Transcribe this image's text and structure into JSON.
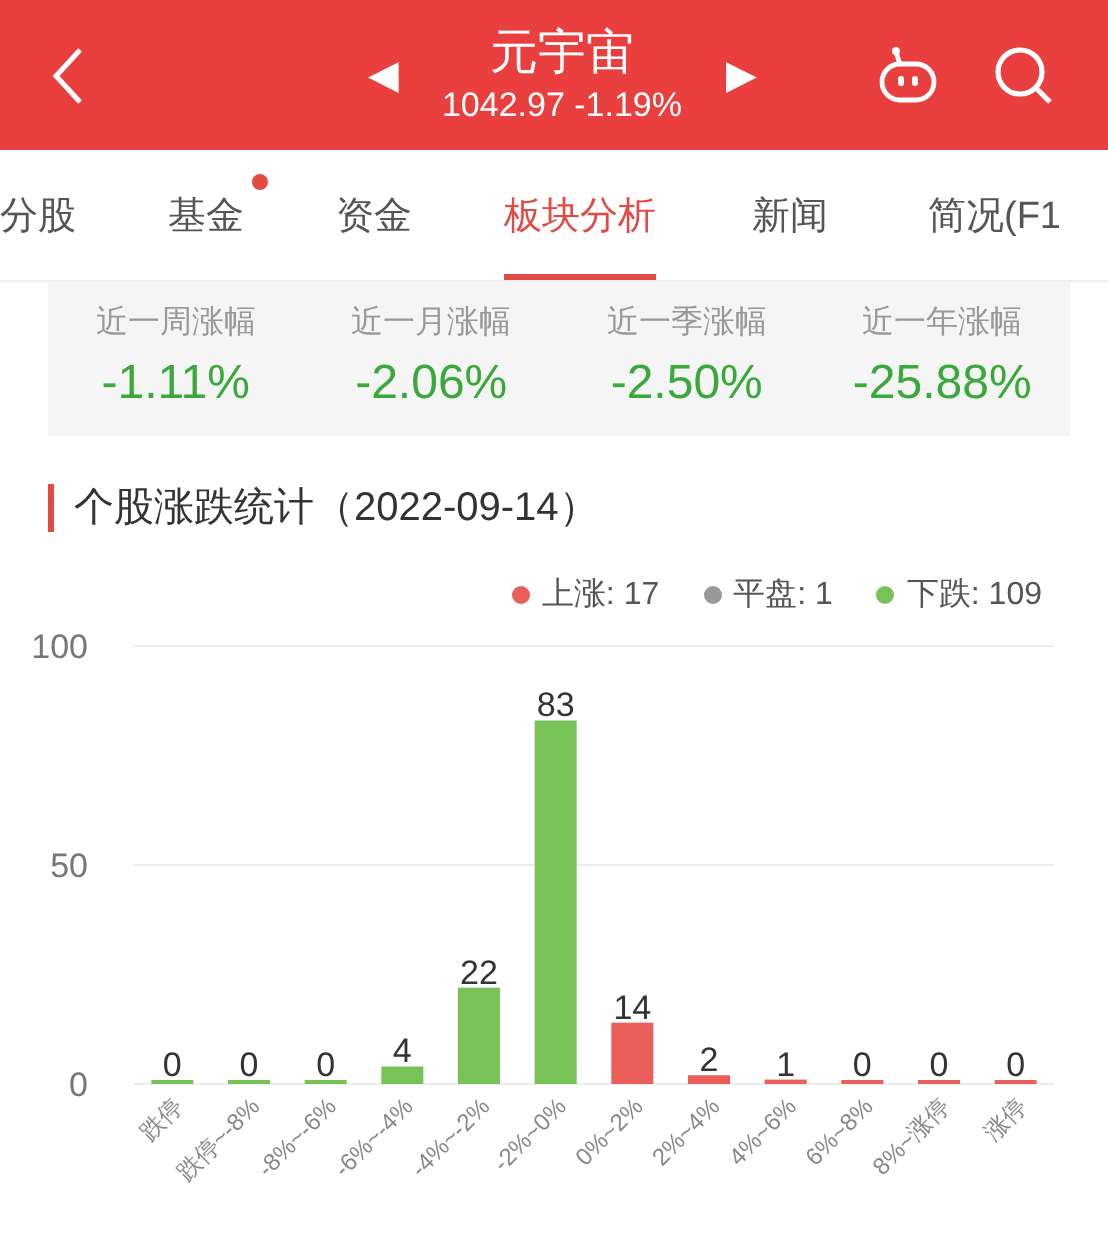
{
  "header": {
    "title": "元宇宙",
    "quote": "1042.97 -1.19%",
    "prev": "◀",
    "next": "▶"
  },
  "tabs": [
    {
      "label": "分股",
      "selected": false,
      "dot": false
    },
    {
      "label": "基金",
      "selected": false,
      "dot": true
    },
    {
      "label": "资金",
      "selected": false,
      "dot": false
    },
    {
      "label": "板块分析",
      "selected": true,
      "dot": false
    },
    {
      "label": "新闻",
      "selected": false,
      "dot": false
    },
    {
      "label": "简况(F1",
      "selected": false,
      "dot": false
    }
  ],
  "stats": [
    {
      "label": "近一周涨幅",
      "value": "-1.11%"
    },
    {
      "label": "近一月涨幅",
      "value": "-2.06%"
    },
    {
      "label": "近一季涨幅",
      "value": "-2.50%"
    },
    {
      "label": "近一年涨幅",
      "value": "-25.88%"
    }
  ],
  "section_title": "个股涨跌统计（2022-09-14）",
  "legend": [
    {
      "label": "上涨: 17",
      "color": "#e8605a"
    },
    {
      "label": "平盘: 1",
      "color": "#999999"
    },
    {
      "label": "下跌: 109",
      "color": "#78c257"
    }
  ],
  "chart_data": {
    "type": "bar",
    "data_labels": true,
    "yticks": [
      0,
      50,
      100
    ],
    "ylim": [
      0,
      100
    ],
    "categories": [
      "跌停",
      "跌停~-8%",
      "-8%~-6%",
      "-6%~-4%",
      "-4%~-2%",
      "-2%~0%",
      "0%~2%",
      "2%~4%",
      "4%~6%",
      "6%~8%",
      "8%~涨停",
      "涨停"
    ],
    "series": [
      {
        "color": "#78c257",
        "values": [
          0,
          0,
          0,
          4,
          22,
          83,
          null,
          null,
          null,
          null,
          null,
          null
        ]
      },
      {
        "color": "#eb5f5a",
        "values": [
          null,
          null,
          null,
          null,
          null,
          null,
          14,
          2,
          1,
          0,
          0,
          0
        ]
      }
    ]
  }
}
